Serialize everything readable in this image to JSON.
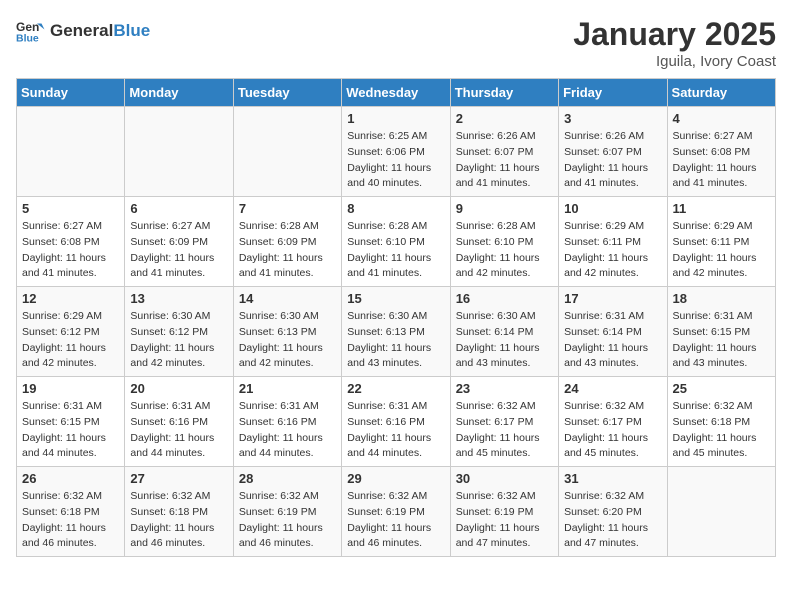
{
  "header": {
    "logo_general": "General",
    "logo_blue": "Blue",
    "month_title": "January 2025",
    "location": "Iguila, Ivory Coast"
  },
  "weekdays": [
    "Sunday",
    "Monday",
    "Tuesday",
    "Wednesday",
    "Thursday",
    "Friday",
    "Saturday"
  ],
  "weeks": [
    [
      {
        "day": "",
        "sunrise": "",
        "sunset": "",
        "daylight": ""
      },
      {
        "day": "",
        "sunrise": "",
        "sunset": "",
        "daylight": ""
      },
      {
        "day": "",
        "sunrise": "",
        "sunset": "",
        "daylight": ""
      },
      {
        "day": "1",
        "sunrise": "Sunrise: 6:25 AM",
        "sunset": "Sunset: 6:06 PM",
        "daylight": "Daylight: 11 hours and 40 minutes."
      },
      {
        "day": "2",
        "sunrise": "Sunrise: 6:26 AM",
        "sunset": "Sunset: 6:07 PM",
        "daylight": "Daylight: 11 hours and 41 minutes."
      },
      {
        "day": "3",
        "sunrise": "Sunrise: 6:26 AM",
        "sunset": "Sunset: 6:07 PM",
        "daylight": "Daylight: 11 hours and 41 minutes."
      },
      {
        "day": "4",
        "sunrise": "Sunrise: 6:27 AM",
        "sunset": "Sunset: 6:08 PM",
        "daylight": "Daylight: 11 hours and 41 minutes."
      }
    ],
    [
      {
        "day": "5",
        "sunrise": "Sunrise: 6:27 AM",
        "sunset": "Sunset: 6:08 PM",
        "daylight": "Daylight: 11 hours and 41 minutes."
      },
      {
        "day": "6",
        "sunrise": "Sunrise: 6:27 AM",
        "sunset": "Sunset: 6:09 PM",
        "daylight": "Daylight: 11 hours and 41 minutes."
      },
      {
        "day": "7",
        "sunrise": "Sunrise: 6:28 AM",
        "sunset": "Sunset: 6:09 PM",
        "daylight": "Daylight: 11 hours and 41 minutes."
      },
      {
        "day": "8",
        "sunrise": "Sunrise: 6:28 AM",
        "sunset": "Sunset: 6:10 PM",
        "daylight": "Daylight: 11 hours and 41 minutes."
      },
      {
        "day": "9",
        "sunrise": "Sunrise: 6:28 AM",
        "sunset": "Sunset: 6:10 PM",
        "daylight": "Daylight: 11 hours and 42 minutes."
      },
      {
        "day": "10",
        "sunrise": "Sunrise: 6:29 AM",
        "sunset": "Sunset: 6:11 PM",
        "daylight": "Daylight: 11 hours and 42 minutes."
      },
      {
        "day": "11",
        "sunrise": "Sunrise: 6:29 AM",
        "sunset": "Sunset: 6:11 PM",
        "daylight": "Daylight: 11 hours and 42 minutes."
      }
    ],
    [
      {
        "day": "12",
        "sunrise": "Sunrise: 6:29 AM",
        "sunset": "Sunset: 6:12 PM",
        "daylight": "Daylight: 11 hours and 42 minutes."
      },
      {
        "day": "13",
        "sunrise": "Sunrise: 6:30 AM",
        "sunset": "Sunset: 6:12 PM",
        "daylight": "Daylight: 11 hours and 42 minutes."
      },
      {
        "day": "14",
        "sunrise": "Sunrise: 6:30 AM",
        "sunset": "Sunset: 6:13 PM",
        "daylight": "Daylight: 11 hours and 42 minutes."
      },
      {
        "day": "15",
        "sunrise": "Sunrise: 6:30 AM",
        "sunset": "Sunset: 6:13 PM",
        "daylight": "Daylight: 11 hours and 43 minutes."
      },
      {
        "day": "16",
        "sunrise": "Sunrise: 6:30 AM",
        "sunset": "Sunset: 6:14 PM",
        "daylight": "Daylight: 11 hours and 43 minutes."
      },
      {
        "day": "17",
        "sunrise": "Sunrise: 6:31 AM",
        "sunset": "Sunset: 6:14 PM",
        "daylight": "Daylight: 11 hours and 43 minutes."
      },
      {
        "day": "18",
        "sunrise": "Sunrise: 6:31 AM",
        "sunset": "Sunset: 6:15 PM",
        "daylight": "Daylight: 11 hours and 43 minutes."
      }
    ],
    [
      {
        "day": "19",
        "sunrise": "Sunrise: 6:31 AM",
        "sunset": "Sunset: 6:15 PM",
        "daylight": "Daylight: 11 hours and 44 minutes."
      },
      {
        "day": "20",
        "sunrise": "Sunrise: 6:31 AM",
        "sunset": "Sunset: 6:16 PM",
        "daylight": "Daylight: 11 hours and 44 minutes."
      },
      {
        "day": "21",
        "sunrise": "Sunrise: 6:31 AM",
        "sunset": "Sunset: 6:16 PM",
        "daylight": "Daylight: 11 hours and 44 minutes."
      },
      {
        "day": "22",
        "sunrise": "Sunrise: 6:31 AM",
        "sunset": "Sunset: 6:16 PM",
        "daylight": "Daylight: 11 hours and 44 minutes."
      },
      {
        "day": "23",
        "sunrise": "Sunrise: 6:32 AM",
        "sunset": "Sunset: 6:17 PM",
        "daylight": "Daylight: 11 hours and 45 minutes."
      },
      {
        "day": "24",
        "sunrise": "Sunrise: 6:32 AM",
        "sunset": "Sunset: 6:17 PM",
        "daylight": "Daylight: 11 hours and 45 minutes."
      },
      {
        "day": "25",
        "sunrise": "Sunrise: 6:32 AM",
        "sunset": "Sunset: 6:18 PM",
        "daylight": "Daylight: 11 hours and 45 minutes."
      }
    ],
    [
      {
        "day": "26",
        "sunrise": "Sunrise: 6:32 AM",
        "sunset": "Sunset: 6:18 PM",
        "daylight": "Daylight: 11 hours and 46 minutes."
      },
      {
        "day": "27",
        "sunrise": "Sunrise: 6:32 AM",
        "sunset": "Sunset: 6:18 PM",
        "daylight": "Daylight: 11 hours and 46 minutes."
      },
      {
        "day": "28",
        "sunrise": "Sunrise: 6:32 AM",
        "sunset": "Sunset: 6:19 PM",
        "daylight": "Daylight: 11 hours and 46 minutes."
      },
      {
        "day": "29",
        "sunrise": "Sunrise: 6:32 AM",
        "sunset": "Sunset: 6:19 PM",
        "daylight": "Daylight: 11 hours and 46 minutes."
      },
      {
        "day": "30",
        "sunrise": "Sunrise: 6:32 AM",
        "sunset": "Sunset: 6:19 PM",
        "daylight": "Daylight: 11 hours and 47 minutes."
      },
      {
        "day": "31",
        "sunrise": "Sunrise: 6:32 AM",
        "sunset": "Sunset: 6:20 PM",
        "daylight": "Daylight: 11 hours and 47 minutes."
      },
      {
        "day": "",
        "sunrise": "",
        "sunset": "",
        "daylight": ""
      }
    ]
  ]
}
